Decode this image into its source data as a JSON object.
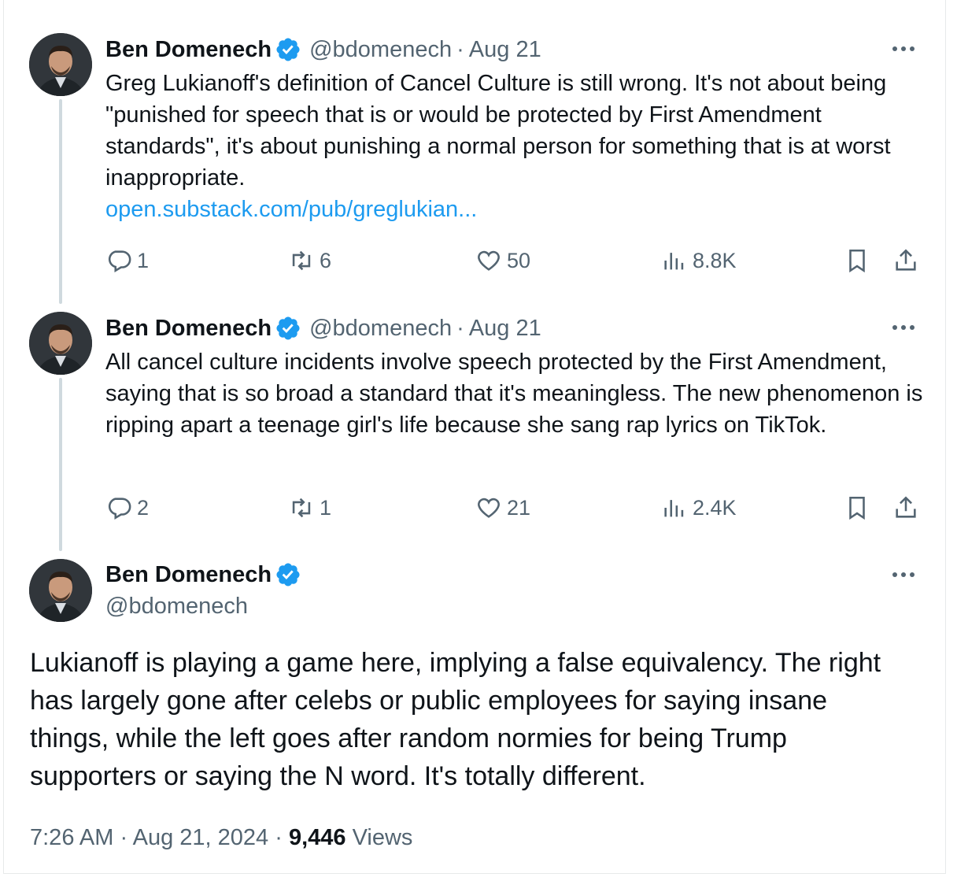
{
  "tweets": [
    {
      "name": "Ben Domenech",
      "handle": "@bdomenech",
      "date": "Aug 21",
      "text": "Greg Lukianoff's definition of Cancel Culture is still wrong. It's not about being \"punished for speech that is or would be protected by First Amendment standards\", it's about punishing a normal person for something that is at worst inappropriate.",
      "link": "open.substack.com/pub/greglukian...",
      "replies": "1",
      "reposts": "6",
      "likes": "50",
      "views": "8.8K"
    },
    {
      "name": "Ben Domenech",
      "handle": "@bdomenech",
      "date": "Aug 21",
      "text": "All cancel culture incidents involve speech protected by the First Amendment, saying that is so broad a standard that it's meaningless. The new phenomenon is ripping apart a teenage girl's life because she sang rap lyrics on TikTok.",
      "replies": "2",
      "reposts": "1",
      "likes": "21",
      "views": "2.4K"
    }
  ],
  "main_tweet": {
    "name": "Ben Domenech",
    "handle": "@bdomenech",
    "text": "Lukianoff is playing a game here, implying a false equivalency. The right has largely gone after celebs or public employees for saying insane things, while the left goes after random normies for being Trump supporters or saying the N word. It's totally different.",
    "time": "7:26 AM",
    "full_date": "Aug 21, 2024",
    "views_count": "9,446",
    "views_label": "Views"
  },
  "separator": "·",
  "icons": {
    "verified": "verified-badge-icon",
    "more": "more-icon",
    "reply": "reply-icon",
    "repost": "repost-icon",
    "like": "like-icon",
    "views": "views-icon",
    "bookmark": "bookmark-icon",
    "share": "share-icon"
  },
  "colors": {
    "accent": "#1d9bf0",
    "text": "#0f1419",
    "secondary": "#536471",
    "thread_line": "#cfd9de"
  }
}
